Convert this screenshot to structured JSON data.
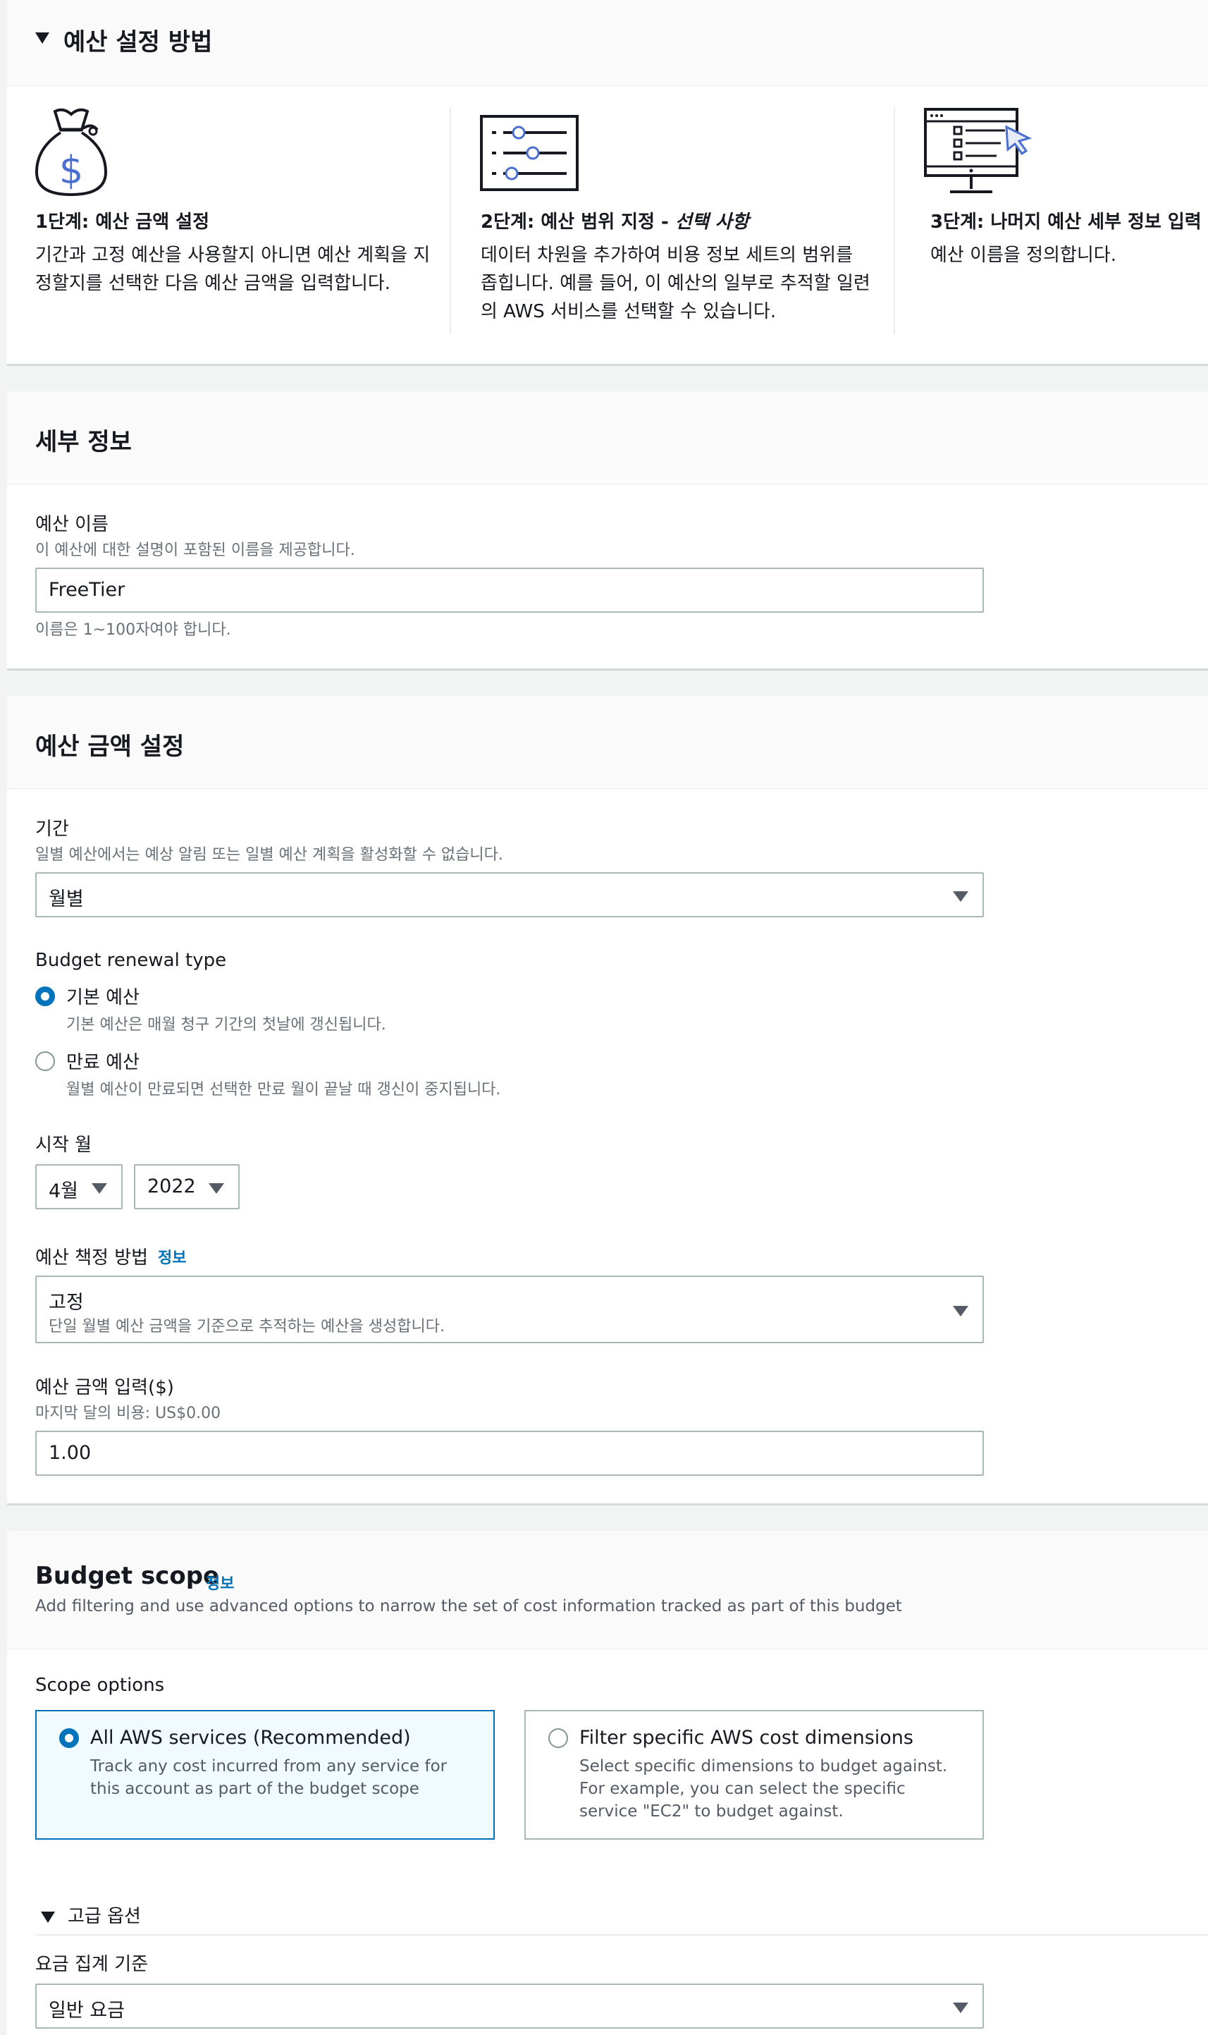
{
  "method": {
    "header": "예산 설정 방법",
    "steps": [
      {
        "title": "1단계: 예산 금액 설정",
        "title_suffix": "",
        "desc": "기간과 고정 예산을 사용할지 아니면 예산 계획을 지정할지를 선택한 다음 예산 금액을 입력합니다."
      },
      {
        "title": "2단계: 예산 범위 지정 - ",
        "title_suffix": "선택 사항",
        "desc": "데이터 차원을 추가하여 비용 정보 세트의 범위를 좁힙니다. 예를 들어, 이 예산의 일부로 추적할 일련의 AWS 서비스를 선택할 수 있습니다."
      },
      {
        "title": "3단계: 나머지 예산 세부 정보 입력",
        "title_suffix": "",
        "desc": "예산 이름을 정의합니다."
      }
    ]
  },
  "details": {
    "header": "세부 정보",
    "name_label": "예산 이름",
    "name_desc": "이 예산에 대한 설명이 포함된 이름을 제공합니다.",
    "name_value": "FreeTier",
    "name_hint": "이름은 1~100자여야 합니다."
  },
  "amount": {
    "header": "예산 금액 설정",
    "period_label": "기간",
    "period_desc": "일별 예산에서는 예상 알림 또는 일별 예산 계획을 활성화할 수 없습니다.",
    "period_value": "월별",
    "renewal_label": "Budget renewal type",
    "renewal_options": [
      {
        "label": "기본 예산",
        "desc": "기본 예산은 매월 청구 기간의 첫날에 갱신됩니다.",
        "selected": true
      },
      {
        "label": "만료 예산",
        "desc": "월별 예산이 만료되면 선택한 만료 월이 끝날 때 갱신이 중지됩니다.",
        "selected": false
      }
    ],
    "start_label": "시작 월",
    "start_month": "4월",
    "start_year": "2022",
    "method_label": "예산 책정 방법",
    "method_info": "정보",
    "method_value": "고정",
    "method_value_desc": "단일 월별 예산 금액을 기준으로 추적하는 예산을 생성합니다.",
    "amount_label": "예산 금액 입력($)",
    "amount_desc": "마지막 달의 비용: US$0.00",
    "amount_value": "1.00"
  },
  "scope": {
    "header": "Budget scope",
    "info": "정보",
    "desc": "Add filtering and use advanced options to narrow the set of cost information tracked as part of this budget",
    "options_label": "Scope options",
    "options": [
      {
        "title": "All AWS services (Recommended)",
        "desc": "Track any cost incurred from any service for this account as part of the budget scope",
        "selected": true
      },
      {
        "title": "Filter specific AWS cost dimensions",
        "desc": "Select specific dimensions to budget against. For example, you can select the specific service \"EC2\" to budget against.",
        "selected": false
      }
    ],
    "advanced_label": "고급 옵션",
    "aggregate_label": "요금 집계 기준",
    "aggregate_value": "일반 요금"
  },
  "colors": {
    "accent": "#0073bb",
    "icon_blue": "#4a6fd0"
  }
}
